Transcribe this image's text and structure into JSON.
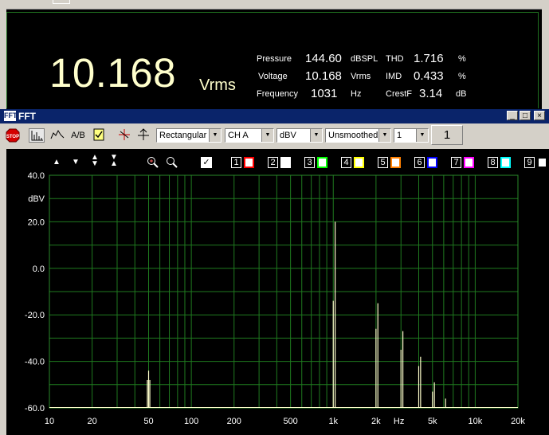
{
  "meter": {
    "big_value": "10.168",
    "big_unit": "Vrms",
    "readings": [
      {
        "label": "Pressure",
        "value": "144.60",
        "unit": "dBSPL"
      },
      {
        "label": "Voltage",
        "value": "10.168",
        "unit": "Vrms"
      },
      {
        "label": "Frequency",
        "value": "1031",
        "unit": "Hz"
      }
    ],
    "readings2": [
      {
        "label": "THD",
        "value": "1.716",
        "unit": "%"
      },
      {
        "label": "IMD",
        "value": "0.433",
        "unit": "%"
      },
      {
        "label": "CrestF",
        "value": "3.14",
        "unit": "dB"
      }
    ]
  },
  "window": {
    "title": "FFT",
    "icon_text": "FFT",
    "minimize": "_",
    "maximize": "□",
    "close": "×"
  },
  "toolbar": {
    "stop_label": "STOP",
    "ab_label": "A/B",
    "window_fn": "Rectangular",
    "channel": "CH A",
    "unit": "dBV",
    "smoothing": "Unsmoothed",
    "avg_select": "1",
    "avg_count": "1"
  },
  "traces": {
    "first_check": "✓",
    "items": [
      {
        "n": "1",
        "color": "#ff0000"
      },
      {
        "n": "2",
        "color": "#ffffff"
      },
      {
        "n": "3",
        "color": "#00ff00"
      },
      {
        "n": "4",
        "color": "#ffff00"
      },
      {
        "n": "5",
        "color": "#ff8000"
      },
      {
        "n": "6",
        "color": "#0000ff"
      },
      {
        "n": "7",
        "color": "#ff00ff"
      },
      {
        "n": "8",
        "color": "#00ffff"
      },
      {
        "n": "9",
        "color": "#000000"
      }
    ]
  },
  "chart_data": {
    "type": "line",
    "xlabel": "Hz",
    "ylabel": "dBV",
    "xscale": "log",
    "xlim": [
      10,
      20000
    ],
    "ylim": [
      -60,
      40
    ],
    "grid": true,
    "x_ticks": [
      "10",
      "20",
      "50",
      "100",
      "200",
      "500",
      "1k",
      "2k",
      "5k",
      "10k",
      "20k"
    ],
    "y_ticks": [
      "40.0",
      "20.0",
      "0.0",
      "-20.0",
      "-40.0",
      "-60.0"
    ],
    "line_color": "#ffffcc",
    "peaks": [
      {
        "x": 49,
        "y": -48
      },
      {
        "x": 50,
        "y": -44
      },
      {
        "x": 51,
        "y": -48
      },
      {
        "x": 1000,
        "y": -14
      },
      {
        "x": 1031,
        "y": 20
      },
      {
        "x": 2000,
        "y": -26
      },
      {
        "x": 2062,
        "y": -15
      },
      {
        "x": 3000,
        "y": -35
      },
      {
        "x": 3093,
        "y": -27
      },
      {
        "x": 4000,
        "y": -42
      },
      {
        "x": 4124,
        "y": -38
      },
      {
        "x": 5000,
        "y": -53
      },
      {
        "x": 5155,
        "y": -49
      },
      {
        "x": 6186,
        "y": -56
      }
    ]
  }
}
